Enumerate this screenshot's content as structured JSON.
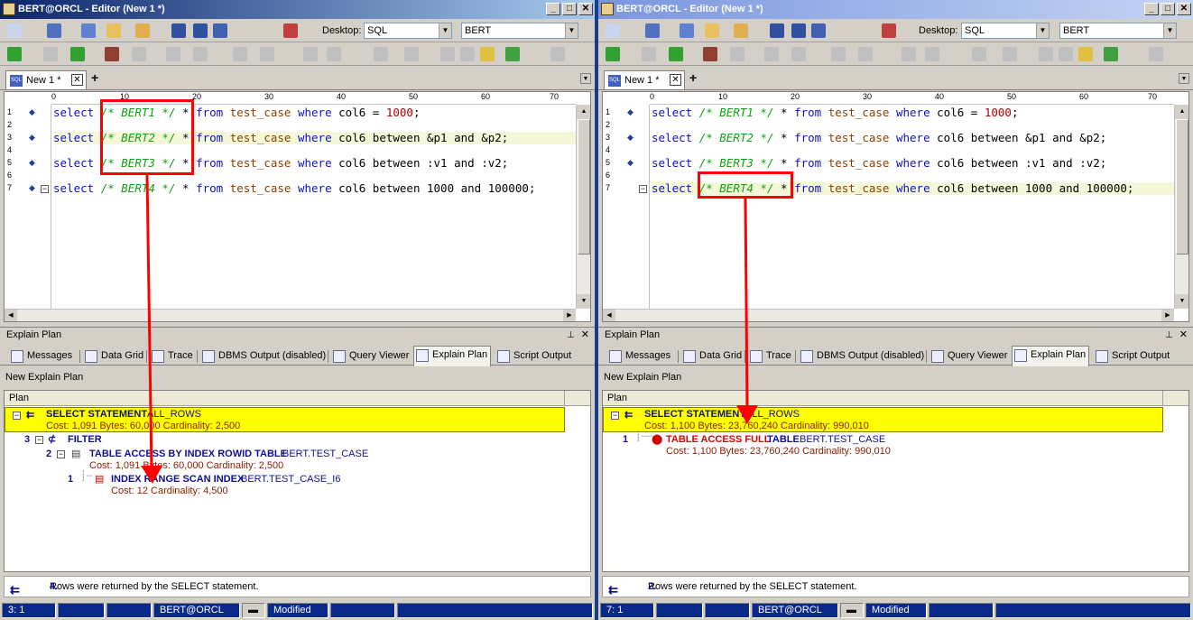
{
  "windows": [
    {
      "id": "left",
      "title": "BERT@ORCL - Editor (New 1 *)",
      "desktop_label": "Desktop:",
      "desktop_value": "SQL",
      "schema_value": "BERT",
      "doc_tab": "New 1 *",
      "ruler": [
        "0",
        "10",
        "20",
        "30",
        "40",
        "50",
        "60",
        "70"
      ],
      "lines": [
        "1",
        "2",
        "3",
        "4",
        "5",
        "6",
        "7"
      ],
      "code": [
        {
          "kw": "select",
          "cm": "/* BERT1 */",
          "rest1": "* ",
          "kw2": "from",
          "id": "test_case",
          "kw3": "where",
          "col": "col6",
          "tail": " = ",
          "num": "1000",
          "end": ";"
        },
        {
          "kw": "select",
          "cm": "/* BERT2 */",
          "rest1": "* ",
          "kw2": "from",
          "id": "test_case",
          "kw3": "where",
          "col": "col6",
          "tail": " between &p1 and &p2;",
          "num": "",
          "end": ""
        },
        {
          "kw": "select",
          "cm": "/* BERT3 */",
          "rest1": "* ",
          "kw2": "from",
          "id": "test_case",
          "kw3": "where",
          "col": "col6",
          "tail": " between :v1 and :v2;",
          "num": "",
          "end": ""
        },
        {
          "kw": "select",
          "cm": "/* BERT4 */",
          "rest1": "* ",
          "kw2": "from",
          "id": "test_case",
          "kw3": "where",
          "col": "col6",
          "tail": " between 1000 and 100000;",
          "num": "",
          "end": ""
        }
      ],
      "panel_title": "Explain Plan",
      "tabs": [
        "Messages",
        "Data Grid",
        "Trace",
        "DBMS Output (disabled)",
        "Query Viewer",
        "Explain Plan",
        "Script Output"
      ],
      "new_explain_plan": "New Explain Plan",
      "plan_header": "Plan",
      "plan": {
        "root_op": "SELECT STATEMENT",
        "root_opt": "ALL_ROWS",
        "root_cost": "Cost: 1,091  Bytes: 60,000  Cardinality: 2,500",
        "n3": "3",
        "filter": "FILTER",
        "n2": "2",
        "tbl_op": "TABLE ACCESS BY INDEX ROWID TABLE",
        "tbl_obj": "BERT.TEST_CASE",
        "tbl_cost": "Cost: 1,091  Bytes: 60,000  Cardinality: 2,500",
        "n1": "1",
        "idx_op": "INDEX RANGE SCAN INDEX",
        "idx_obj": "BERT.TEST_CASE_I6",
        "idx_cost": "Cost: 12  Cardinality: 4,500"
      },
      "rows_count": "4.",
      "rows_text": "Rows were returned by the SELECT statement.",
      "status": {
        "pos": "3:  1",
        "conn": "BERT@ORCL",
        "mod": "Modified"
      }
    },
    {
      "id": "right",
      "title": "BERT@ORCL - Editor (New 1 *)",
      "desktop_label": "Desktop:",
      "desktop_value": "SQL",
      "schema_value": "BERT",
      "doc_tab": "New 1 *",
      "panel_title": "Explain Plan",
      "new_explain_plan": "New Explain Plan",
      "plan_header": "Plan",
      "plan": {
        "root_op": "SELECT STATEMENT",
        "root_opt": "ALL_ROWS",
        "root_cost": "Cost: 1,100  Bytes: 23,760,240  Cardinality: 990,010",
        "n1": "1",
        "full_op": "TABLE ACCESS FULL",
        "full_op2": "TABLE",
        "full_obj": "BERT.TEST_CASE",
        "full_cost": "Cost: 1,100  Bytes: 23,760,240  Cardinality: 990,010"
      },
      "rows_count": "2.",
      "rows_text": "Rows were returned by the SELECT statement.",
      "status": {
        "pos": "7:  1",
        "conn": "BERT@ORCL",
        "mod": "Modified"
      }
    }
  ],
  "colors": {
    "highlight": "#ffff00",
    "annotation": "#ff0000",
    "title_start": "#0a246a"
  }
}
